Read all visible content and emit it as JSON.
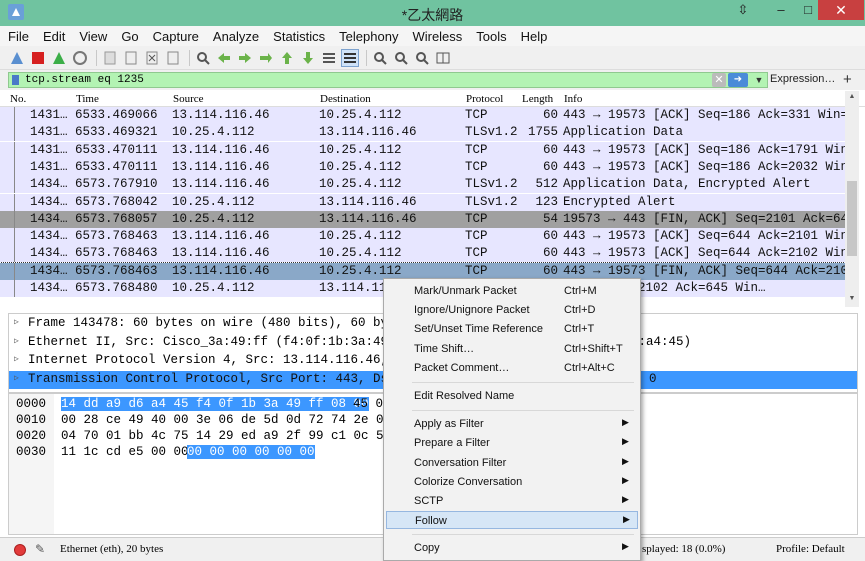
{
  "window": {
    "title": "*乙太網路"
  },
  "menu": [
    "File",
    "Edit",
    "View",
    "Go",
    "Capture",
    "Analyze",
    "Statistics",
    "Telephony",
    "Wireless",
    "Tools",
    "Help"
  ],
  "filter": {
    "value": "tcp.stream eq 1235",
    "expression_label": "Expression…",
    "clear_label": "✕",
    "apply_label": "➜"
  },
  "columns": [
    "No.",
    "Time",
    "Source",
    "Destination",
    "Protocol",
    "Length",
    "Info"
  ],
  "packets": [
    {
      "no": "1431…",
      "time": "6533.469066",
      "src": "13.114.116.46",
      "dst": "10.25.4.112",
      "proto": "TCP",
      "len": "60",
      "info": "443 → 19573 [ACK] Seq=186 Ack=331 Win=…",
      "style": "tcp"
    },
    {
      "no": "1431…",
      "time": "6533.469321",
      "src": "10.25.4.112",
      "dst": "13.114.116.46",
      "proto": "TLSv1.2",
      "len": "1755",
      "info": "Application Data",
      "style": "tcp"
    },
    {
      "no": "1431…",
      "time": "6533.470111",
      "src": "13.114.116.46",
      "dst": "10.25.4.112",
      "proto": "TCP",
      "len": "60",
      "info": "443 → 19573 [ACK] Seq=186 Ack=1791 Win…",
      "style": "tcp"
    },
    {
      "no": "1431…",
      "time": "6533.470111",
      "src": "13.114.116.46",
      "dst": "10.25.4.112",
      "proto": "TCP",
      "len": "60",
      "info": "443 → 19573 [ACK] Seq=186 Ack=2032 Win…",
      "style": "tcp"
    },
    {
      "no": "1434…",
      "time": "6573.767910",
      "src": "13.114.116.46",
      "dst": "10.25.4.112",
      "proto": "TLSv1.2",
      "len": "512",
      "info": "Application Data, Encrypted Alert",
      "style": "tcp"
    },
    {
      "no": "1434…",
      "time": "6573.768042",
      "src": "10.25.4.112",
      "dst": "13.114.116.46",
      "proto": "TLSv1.2",
      "len": "123",
      "info": "Encrypted Alert",
      "style": "tcp"
    },
    {
      "no": "1434…",
      "time": "6573.768057",
      "src": "10.25.4.112",
      "dst": "13.114.116.46",
      "proto": "TCP",
      "len": "54",
      "info": "19573 → 443 [FIN, ACK] Seq=2101 Ack=64…",
      "style": "fin"
    },
    {
      "no": "1434…",
      "time": "6573.768463",
      "src": "13.114.116.46",
      "dst": "10.25.4.112",
      "proto": "TCP",
      "len": "60",
      "info": "443 → 19573 [ACK] Seq=644 Ack=2101 Win…",
      "style": "tcp"
    },
    {
      "no": "1434…",
      "time": "6573.768463",
      "src": "13.114.116.46",
      "dst": "10.25.4.112",
      "proto": "TCP",
      "len": "60",
      "info": "443 → 19573 [ACK] Seq=644 Ack=2102 Win…",
      "style": "tcp"
    },
    {
      "no": "1434…",
      "time": "6573.768463",
      "src": "13.114.116.46",
      "dst": "10.25.4.112",
      "proto": "TCP",
      "len": "60",
      "info": "443 → 19573 [FIN, ACK] Seq=644 Ack=210…",
      "style": "selected"
    },
    {
      "no": "1434…",
      "time": "6573.768480",
      "src": "10.25.4.112",
      "dst": "13.114.11",
      "proto": "",
      "len": "",
      "info": "[ACK] Seq=2102 Ack=645 Win…",
      "style": "tcp"
    }
  ],
  "details": [
    {
      "text": "Frame 143478: 60 bytes on wire (480 bits), 60 bytes",
      "selected": false
    },
    {
      "text": "Ethernet II, Src: Cisco_3a:49:ff (f4:0f:1b:3a:49:f",
      "extra": "6:a4:45)",
      "selected": false
    },
    {
      "text": "Internet Protocol Version 4, Src: 13.114.116.46, Ds",
      "selected": false
    },
    {
      "text": "Transmission Control Protocol, Src Port: 443, Dst P",
      "extra": "0",
      "selected": true
    }
  ],
  "bytes": [
    {
      "offset": "0000",
      "hex": "14 dd a9 d6 a4 45 f4 0f  1b 3a 49 ff 08 00",
      "tail": " 45 0"
    },
    {
      "offset": "0010",
      "hex": "00 28 ce 49 40 00 3e 06  de 5d 0d 72 74 2e 0a 1",
      "tail": ""
    },
    {
      "offset": "0020",
      "hex": "04 70 01 bb 4c 75 14 29  ed a9 2f 99 c1 0c 50 1",
      "tail": ""
    },
    {
      "offset": "0030",
      "hex": "11 1c cd e5 00 00",
      "hl2": "00 00  00 00 00 00",
      "tail": ""
    }
  ],
  "context_menu": [
    {
      "label": "Mark/Unmark Packet",
      "shortcut": "Ctrl+M"
    },
    {
      "label": "Ignore/Unignore Packet",
      "shortcut": "Ctrl+D"
    },
    {
      "label": "Set/Unset Time Reference",
      "shortcut": "Ctrl+T"
    },
    {
      "label": "Time Shift…",
      "shortcut": "Ctrl+Shift+T"
    },
    {
      "label": "Packet Comment…",
      "shortcut": "Ctrl+Alt+C"
    },
    {
      "sep": true
    },
    {
      "label": "Edit Resolved Name",
      "shortcut": ""
    },
    {
      "sep": true
    },
    {
      "label": "Apply as Filter",
      "submenu": true
    },
    {
      "label": "Prepare a Filter",
      "submenu": true
    },
    {
      "label": "Conversation Filter",
      "submenu": true
    },
    {
      "label": "Colorize Conversation",
      "submenu": true
    },
    {
      "label": "SCTP",
      "submenu": true
    },
    {
      "label": "Follow",
      "submenu": true,
      "highlighted": true
    },
    {
      "sep": true
    },
    {
      "label": "Copy",
      "submenu": true
    }
  ],
  "status": {
    "interface": "Ethernet (eth), 20 bytes",
    "displayed": "splayed: 18 (0.0%)",
    "profile": "Profile: Default"
  },
  "colors": {
    "tcp_row": "#e7e6ff",
    "fin_row": "#a0a0a0",
    "selected_row": "#8aa8c8",
    "filter_ok": "#b3f3b3",
    "selected_detail": "#3c97ff"
  }
}
